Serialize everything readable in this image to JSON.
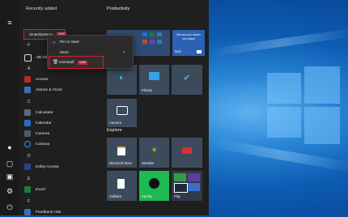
{
  "sections": {
    "recently_added": "Recently added",
    "productivity": "Productivity",
    "explore": "Explore"
  },
  "apps": {
    "smartsystems": "SmartSystems",
    "three_d_viewer": "3D Viewer",
    "access": "Access",
    "alarms": "Alarms & Clock",
    "calculator": "Calculator",
    "calendar": "Calendar",
    "camera": "Camera",
    "cortana": "Cortana",
    "dolby": "Dolby Access",
    "excel": "Excel",
    "feedback": "Feedback Hub"
  },
  "letters": {
    "a": "A",
    "c": "C",
    "d": "D",
    "e": "E",
    "f": "F",
    "num": "#"
  },
  "context_menu": {
    "pin": "Pin to Start",
    "more": "More",
    "uninstall": "Uninstall",
    "badge": "NEW"
  },
  "tiles": {
    "mail_text": "See all your mail in one place",
    "mail": "Mail",
    "edge": "",
    "photos": "Photos",
    "camera": "Camera",
    "store": "Microsoft Store",
    "weather": "Weather",
    "solitaire": "Solitaire",
    "spotify": "Spotify",
    "play": "Play"
  }
}
